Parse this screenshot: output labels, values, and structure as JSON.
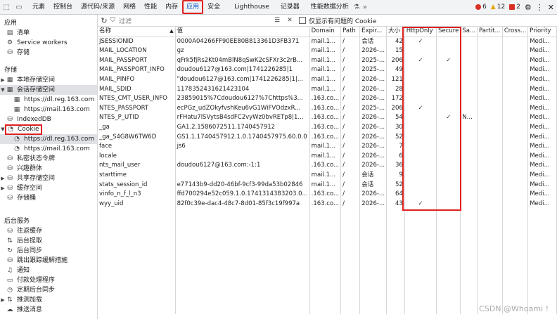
{
  "topbar": {
    "tabs": [
      {
        "label": "元素"
      },
      {
        "label": "控制台"
      },
      {
        "label": "源代码/来源"
      },
      {
        "label": "网络"
      },
      {
        "label": "性能"
      },
      {
        "label": "内存"
      },
      {
        "label": "应用"
      },
      {
        "label": "安全"
      },
      {
        "label": "Lighthouse"
      },
      {
        "label": "记录器"
      },
      {
        "label": "性能数据分析"
      }
    ],
    "errors": "6",
    "warnings": "12",
    "issues": "2"
  },
  "sidebar": {
    "section_app": "应用",
    "app_items": [
      {
        "label": "清单"
      },
      {
        "label": "Service workers"
      },
      {
        "label": "存储"
      }
    ],
    "section_storage": "存储",
    "storage_items": [
      {
        "label": "本地存储空间"
      },
      {
        "label": "会话存储空间"
      },
      {
        "label": "https://dl.reg.163.com"
      },
      {
        "label": "https://mail.163.com"
      },
      {
        "label": "IndexedDB"
      },
      {
        "label": "Cookie"
      },
      {
        "label": "https://dl.reg.163.com"
      },
      {
        "label": "https://mail.163.com"
      },
      {
        "label": "私密状态令牌"
      },
      {
        "label": "兴趣群体"
      },
      {
        "label": "共享存储空间"
      },
      {
        "label": "缓存空间"
      },
      {
        "label": "存储桶"
      }
    ],
    "section_bg": "后台服务",
    "bg_items": [
      {
        "label": "往返缓存"
      },
      {
        "label": "后台提取"
      },
      {
        "label": "后台同步"
      },
      {
        "label": "跳出跟踪缓解措施"
      },
      {
        "label": "通知"
      },
      {
        "label": "付款处理程序"
      },
      {
        "label": "定期后台同步"
      },
      {
        "label": "推测加载"
      },
      {
        "label": "推送消息"
      }
    ]
  },
  "filter": {
    "placeholder": "过滤",
    "only_issues_label": "仅显示有问题的 Cookie"
  },
  "table": {
    "headers": [
      "名称",
      "值",
      "Domain",
      "Path",
      "Expir...",
      "大小",
      "HttpOnly",
      "Secure",
      "Sa...",
      "Partit...",
      "Cross...",
      "Priority"
    ],
    "rows": [
      [
        "JSESSIONID",
        "0000A04266FF90EE80B813361D3FB371",
        "mail.1...",
        "/",
        "会话",
        "42",
        "✓",
        "",
        "",
        "",
        "",
        "Medi..."
      ],
      [
        "MAIL_LOCATION",
        "gz",
        "mail.1...",
        "/",
        "2026-...",
        "15",
        "",
        "",
        "",
        "",
        "",
        "Medi..."
      ],
      [
        "MAIL_PASSPORT",
        "qFrk5fjRs2Kt04mBlN8qSwK2cSFXr3c2rB...",
        "mail.1...",
        "/",
        "2025-...",
        "206",
        "✓",
        "✓",
        "",
        "",
        "",
        "Medi..."
      ],
      [
        "MAIL_PASSPORT_INFO",
        "doudou6127@163.com|1741226285|1",
        "mail.1...",
        "/",
        "2025-...",
        "49",
        "",
        "",
        "",
        "",
        "",
        "Medi..."
      ],
      [
        "MAIL_PINFO",
        "\"doudou6127@163.com|1741226285|1|...",
        "mail.1...",
        "/",
        "2026-...",
        "121",
        "",
        "",
        "",
        "",
        "",
        "Medi..."
      ],
      [
        "MAIL_SDID",
        "1178352431621423104",
        "mail.1...",
        "/",
        "2026-...",
        "28",
        "",
        "",
        "",
        "",
        "",
        "Medi..."
      ],
      [
        "NTES_CMT_USER_INFO",
        "23859015%7Cdoudou6127%7Chttps%3...",
        ".163.co...",
        "/",
        "2026-...",
        "172",
        "",
        "",
        "",
        "",
        "",
        "Medi..."
      ],
      [
        "NTES_PASSPORT",
        "ecPGz_udZOkyfvshKeu6vG1WiFVOdzxR...",
        ".163.co...",
        "/",
        "2025-...",
        "206",
        "✓",
        "",
        "",
        "",
        "",
        "Medi..."
      ],
      [
        "NTES_P_UTID",
        "rFHatu7lSVytsB4sdFC2vyWz0bvRETp8|1...",
        ".163.co...",
        "/",
        "2026-...",
        "54",
        "",
        "✓",
        "N...",
        "",
        "",
        "Medi..."
      ],
      [
        "_ga",
        "GA1.2.1586072511.1740457912",
        ".163.co...",
        "/",
        "2026-...",
        "30",
        "",
        "",
        "",
        "",
        "",
        "Medi..."
      ],
      [
        "_ga_S4G8W6TW6D",
        "GS1.1.1740457912.1.0.1740457975.60.0.0",
        ".163.co...",
        "/",
        "2026-...",
        "52",
        "",
        "",
        "",
        "",
        "",
        "Medi..."
      ],
      [
        "face",
        "js6",
        "mail.1...",
        "/",
        "2026-...",
        "7",
        "",
        "",
        "",
        "",
        "",
        "Medi..."
      ],
      [
        "locale",
        "",
        "mail.1...",
        "/",
        "2026-...",
        "6",
        "",
        "",
        "",
        "",
        "",
        "Medi..."
      ],
      [
        "nts_mail_user",
        "doudou6127@163.com:-1:1",
        ".163.co...",
        "/",
        "2026-...",
        "36",
        "",
        "",
        "",
        "",
        "",
        "Medi..."
      ],
      [
        "starttime",
        "",
        "mail.1...",
        "/",
        "会话",
        "9",
        "",
        "",
        "",
        "",
        "",
        "Medi..."
      ],
      [
        "stats_session_id",
        "e77143b9-dd20-46bf-9cf3-99da53b02846",
        "mail.1...",
        "/",
        "会话",
        "52",
        "",
        "",
        "",
        "",
        "",
        "Medi..."
      ],
      [
        "vinfo_n_f_l_n3",
        "ffd700294e52c059.1.0.1741314383203.0...",
        ".163.co...",
        "/",
        "2026-...",
        "64",
        "",
        "",
        "",
        "",
        "",
        "Medi..."
      ],
      [
        "wyy_uid",
        "82f0c39e-dac4-48c7-8d01-85f3c19f997a",
        ".163.co...",
        "/",
        "2026-...",
        "43",
        "✓",
        "",
        "",
        "",
        "",
        "Medi..."
      ]
    ]
  },
  "watermark": "CSDN @Whoami !",
  "colors": {
    "highlight": "#e02020",
    "accent": "#0b57d0"
  }
}
